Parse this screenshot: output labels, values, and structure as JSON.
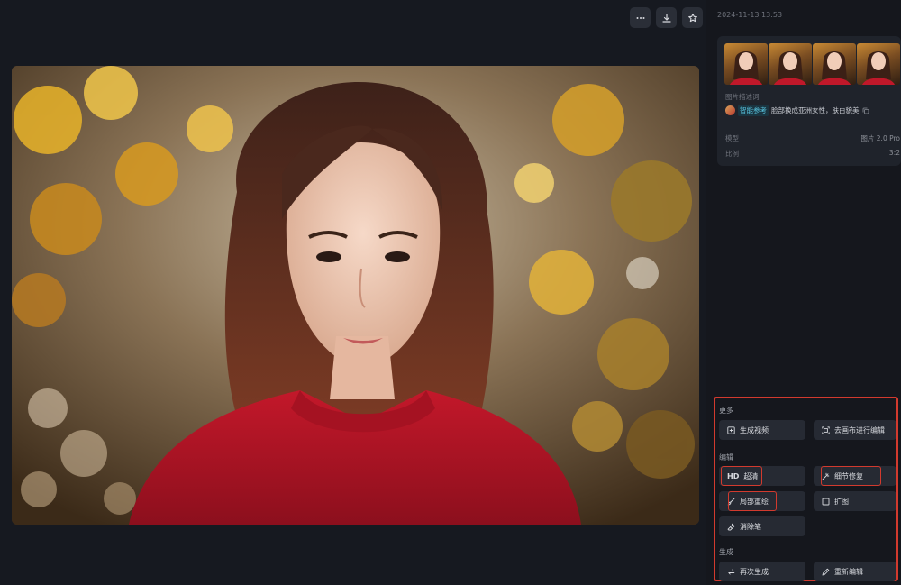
{
  "toolbar": {
    "more_icon": "more-horizontal-icon",
    "download_icon": "download-icon",
    "favorite_icon": "star-icon"
  },
  "sidebar": {
    "timestamp": "2024-11-13 13:53",
    "prompt": {
      "label": "图片描述词",
      "tag": "智能参考",
      "text": "脸部换成亚洲女性，肤白貌美"
    },
    "meta": [
      {
        "key": "模型",
        "value": "图片 2.0 Pro"
      },
      {
        "key": "比例",
        "value": "3:2"
      }
    ]
  },
  "actions": {
    "more": {
      "title": "更多",
      "generate_video": "生成视频",
      "canvas_edit": "去画布进行编辑"
    },
    "edit": {
      "title": "编辑",
      "hd_badge": "HD",
      "upscale": "超清",
      "detail_repair": "细节修复",
      "inpaint": "局部重绘",
      "outpaint": "扩图",
      "eraser": "消除笔"
    },
    "generate": {
      "title": "生成",
      "regenerate": "再次生成",
      "reedit": "重新编辑"
    }
  },
  "colors": {
    "highlight": "#d23a2e",
    "accent_tag": "#57c1dc",
    "background": "#171a21"
  }
}
